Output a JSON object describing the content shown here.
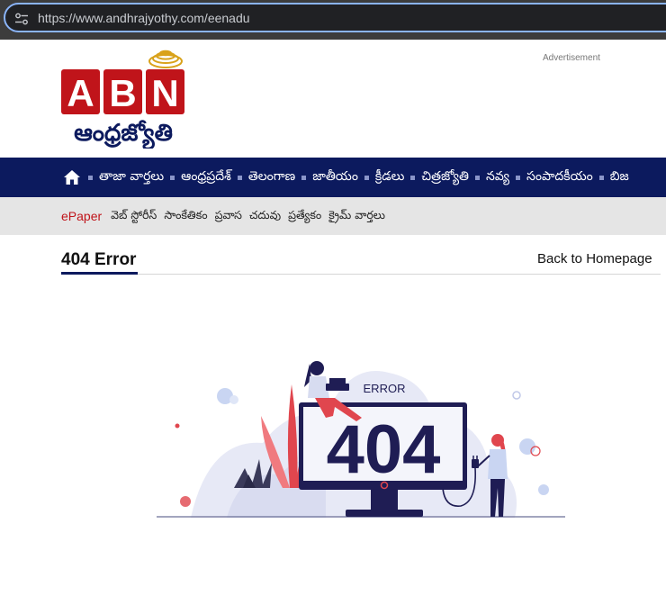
{
  "browser": {
    "url": "https://www.andhrajyothy.com/eenadu"
  },
  "logo": {
    "abn": [
      "A",
      "B",
      "N"
    ],
    "subtitle": "ఆంధ్రజ్యోతి"
  },
  "header": {
    "ad_label": "Advertisement"
  },
  "main_nav": {
    "items": [
      {
        "label": "తాజా వార్తలు"
      },
      {
        "label": "ఆంధ్రప్రదేశ్"
      },
      {
        "label": "తెలంగాణ"
      },
      {
        "label": "జాతీయం"
      },
      {
        "label": "క్రీడలు"
      },
      {
        "label": "చిత్రజ్యోతి"
      },
      {
        "label": "నవ్య"
      },
      {
        "label": "సంపాదకీయం"
      },
      {
        "label": "బిజ"
      }
    ]
  },
  "sub_nav": {
    "epaper": "ePaper",
    "items": [
      {
        "label": "వెబ్ స్టోరీస్"
      },
      {
        "label": "సాంకేతికం"
      },
      {
        "label": "ప్రవాస"
      },
      {
        "label": "చదువు"
      },
      {
        "label": "ప్రత్యేకం"
      },
      {
        "label": "క్రైమ్ వార్తలు"
      }
    ]
  },
  "error_page": {
    "title": "404 Error",
    "back_link": "Back to Homepage",
    "illustration": {
      "label": "ERROR",
      "code": "404"
    }
  },
  "colors": {
    "nav_bg": "#0c1a5e",
    "subnav_bg": "#e5e5e5",
    "logo_red": "#c0141a",
    "epaper_red": "#c0141a"
  }
}
